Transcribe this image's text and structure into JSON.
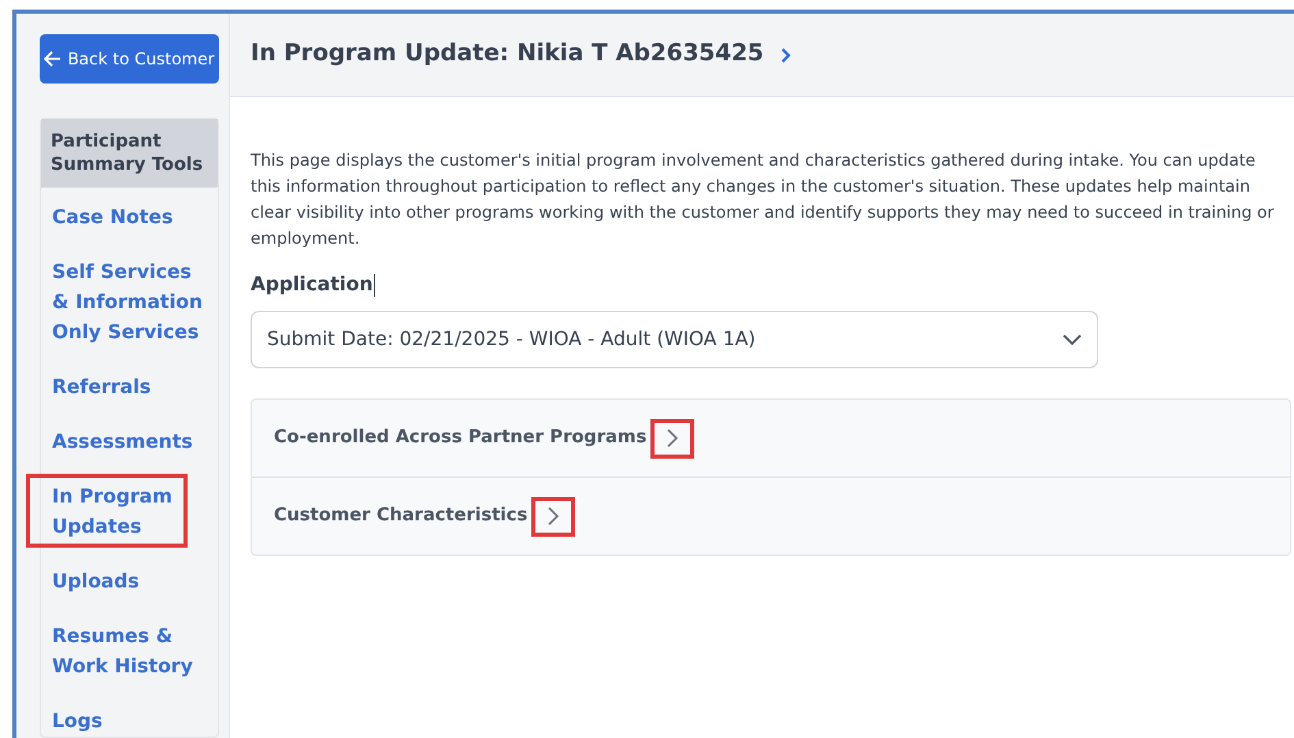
{
  "back_button": {
    "label": "Back to Customer"
  },
  "sidebar": {
    "title": "Participant Summary Tools",
    "items": [
      {
        "label": "Case Notes",
        "highlighted": false
      },
      {
        "label": "Self Services & Information Only Services",
        "highlighted": false
      },
      {
        "label": "Referrals",
        "highlighted": false
      },
      {
        "label": "Assessments",
        "highlighted": false
      },
      {
        "label": "In Program Updates",
        "highlighted": true
      },
      {
        "label": "Uploads",
        "highlighted": false
      },
      {
        "label": "Resumes & Work History",
        "highlighted": false
      },
      {
        "label": "Logs",
        "highlighted": false
      }
    ]
  },
  "header": {
    "title": "In Program Update: Nikia T Ab2635425"
  },
  "description": "This page displays the customer's initial program involvement and characteristics gathered during intake. You can update this information throughout participation to reflect any changes in the customer's situation. These updates help maintain clear visibility into other programs working with the customer and identify supports they may need to succeed in training or employment.",
  "application": {
    "label": "Application",
    "value": "Submit Date: 02/21/2025 - WIOA - Adult (WIOA 1A)"
  },
  "sections": [
    {
      "label": "Co-enrolled Across Partner Programs",
      "expanded": false,
      "highlighted": true
    },
    {
      "label": "Customer Characteristics",
      "expanded": false,
      "highlighted": true
    }
  ]
}
